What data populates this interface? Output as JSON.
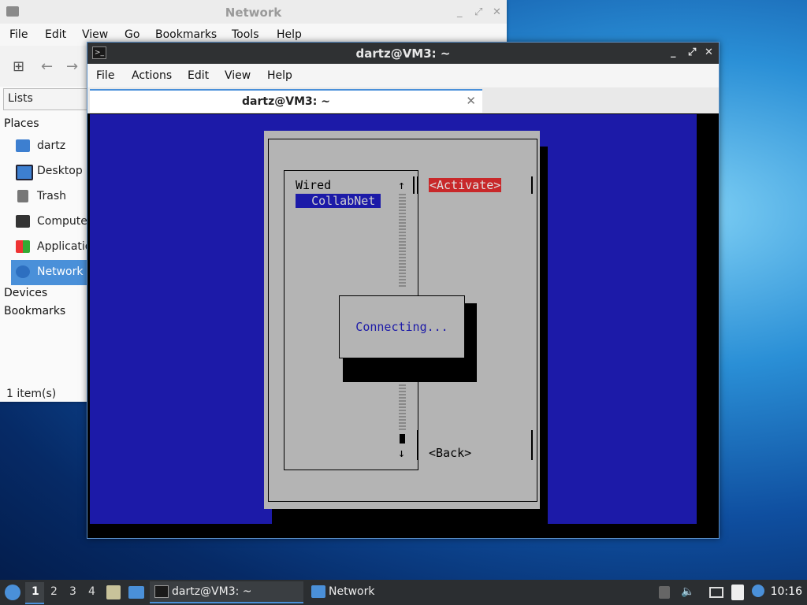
{
  "file_manager": {
    "title": "Network",
    "menu": [
      "File",
      "Edit",
      "View",
      "Go",
      "Bookmarks",
      "Tools",
      "Help"
    ],
    "sidebar_mode": "Lists",
    "places_heading": "Places",
    "places": [
      "dartz",
      "Desktop",
      "Trash",
      "Computer",
      "Applications",
      "Network"
    ],
    "selected_place": "Network",
    "devices_heading": "Devices",
    "bookmarks_heading": "Bookmarks",
    "status": "1 item(s)"
  },
  "terminal": {
    "title": "dartz@VM3: ~",
    "menu": [
      "File",
      "Actions",
      "Edit",
      "View",
      "Help"
    ],
    "tab_label": "dartz@VM3: ~",
    "nmtui": {
      "list_heading": "Wired",
      "connection": "CollabNet",
      "activate_button": "<Activate>",
      "back_button": "<Back>",
      "scroll_up": "↑",
      "scroll_down": "↓",
      "progress_message": "Connecting..."
    }
  },
  "taskbar": {
    "workspaces": [
      "1",
      "2",
      "3",
      "4"
    ],
    "current_workspace": "1",
    "tasks": [
      "dartz@VM3: ~",
      "Network"
    ],
    "clock": "10:16"
  },
  "colors": {
    "terminal_blue": "#1c1aa8",
    "dialog_gray": "#b4b4b4",
    "activate_red": "#c8282a",
    "accent": "#4a90d9"
  }
}
